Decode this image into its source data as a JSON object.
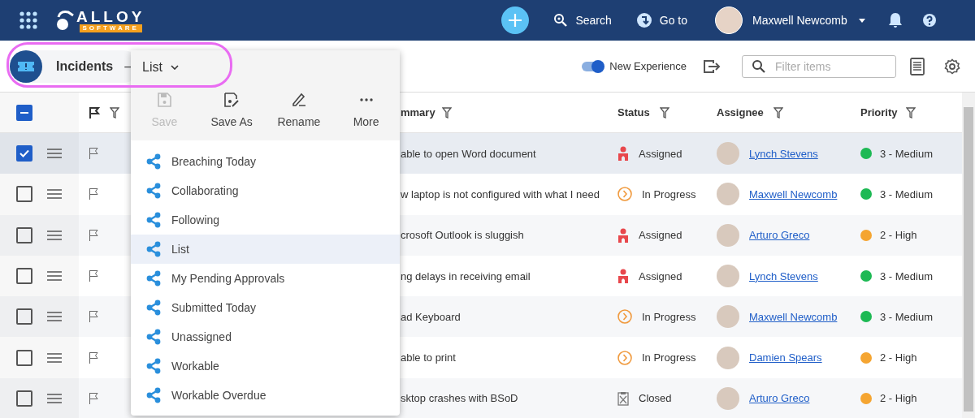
{
  "topbar": {
    "logo_word": "ALLOY",
    "logo_tagline": "SOFTWARE",
    "search_label": "Search",
    "goto_label": "Go to",
    "user_name": "Maxwell Newcomb"
  },
  "toolbar": {
    "title": "Incidents",
    "separator": "–",
    "view_label": "List",
    "toggle": {
      "label": "New Experience",
      "on": true
    },
    "filter_placeholder": "Filter items"
  },
  "view_menu": {
    "actions": [
      {
        "label": "Save",
        "kind": "save",
        "disabled": true
      },
      {
        "label": "Save As",
        "kind": "save_as",
        "disabled": false
      },
      {
        "label": "Rename",
        "kind": "rename",
        "disabled": false
      },
      {
        "label": "More",
        "kind": "more",
        "disabled": false
      }
    ],
    "items": [
      {
        "label": "Breaching Today",
        "selected": false
      },
      {
        "label": "Collaborating",
        "selected": false
      },
      {
        "label": "Following",
        "selected": false
      },
      {
        "label": "List",
        "selected": true
      },
      {
        "label": "My Pending Approvals",
        "selected": false
      },
      {
        "label": "Submitted Today",
        "selected": false
      },
      {
        "label": "Unassigned",
        "selected": false
      },
      {
        "label": "Workable",
        "selected": false
      },
      {
        "label": "Workable Overdue",
        "selected": false
      }
    ]
  },
  "table": {
    "select_all_indeterminate": true,
    "columns": [
      {
        "label": "mmary"
      },
      {
        "label": "Status"
      },
      {
        "label": "Assignee"
      },
      {
        "label": "Priority"
      }
    ],
    "rows": [
      {
        "checked": true,
        "summary": "able to open Word document",
        "status": {
          "label": "Assigned",
          "kind": "assigned"
        },
        "assignee": "Lynch Stevens",
        "priority": {
          "label": "3 - Medium",
          "color": "#1db954"
        }
      },
      {
        "checked": false,
        "summary": "w laptop is not configured with what I need",
        "status": {
          "label": "In Progress",
          "kind": "in_progress"
        },
        "assignee": "Maxwell Newcomb",
        "priority": {
          "label": "3 - Medium",
          "color": "#1db954"
        }
      },
      {
        "checked": false,
        "summary": "crosoft Outlook is sluggish",
        "status": {
          "label": "Assigned",
          "kind": "assigned"
        },
        "assignee": "Arturo Greco",
        "priority": {
          "label": "2 - High",
          "color": "#f5a531"
        }
      },
      {
        "checked": false,
        "summary": "ng delays in receiving email",
        "status": {
          "label": "Assigned",
          "kind": "assigned"
        },
        "assignee": "Lynch Stevens",
        "priority": {
          "label": "3 - Medium",
          "color": "#1db954"
        }
      },
      {
        "checked": false,
        "summary": "ad Keyboard",
        "status": {
          "label": "In Progress",
          "kind": "in_progress"
        },
        "assignee": "Maxwell Newcomb",
        "priority": {
          "label": "3 - Medium",
          "color": "#1db954"
        }
      },
      {
        "checked": false,
        "summary": "able to print",
        "status": {
          "label": "In Progress",
          "kind": "in_progress"
        },
        "assignee": "Damien Spears",
        "priority": {
          "label": "2 - High",
          "color": "#f5a531"
        }
      },
      {
        "checked": false,
        "summary": "sktop crashes with BSoD",
        "status": {
          "label": "Closed",
          "kind": "closed"
        },
        "assignee": "Arturo Greco",
        "priority": {
          "label": "2 - High",
          "color": "#f5a531"
        }
      }
    ]
  }
}
